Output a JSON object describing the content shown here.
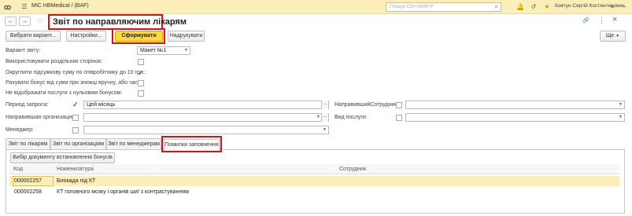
{
  "app": {
    "title": "МІС НВMedical /  (BAF)",
    "search_placeholder": "Пошук Ctrl+Shift+F",
    "user": "Ковтун Сергій Костянтинович"
  },
  "header": {
    "title": "Звіт по направляючим лікарям",
    "back": "←",
    "forward": "→",
    "star": "☆",
    "link": "🔗",
    "more": "⋮",
    "close": "×"
  },
  "toolbar": {
    "select_variant": "Вибрати варіант...",
    "settings": "Настройки...",
    "generate": "Сформувати",
    "print": "Надрукувати",
    "more": "Ще"
  },
  "form": {
    "variant_label": "Варіант звіту:",
    "variant_value": "Макет №1",
    "page_separator_label": "Використовувати роздільник сторінок:",
    "round_label": "Округлити підсумкову суму по співробітнику до 10 грн.:",
    "bonus_calc_label": "Рахувати бонус від суми при знижці вручну, або часу:",
    "zero_bonus_label": "Не відображати послуги з нульовим бонусом:",
    "period_label": "Период запроса:",
    "period_value": "Цей місяць",
    "org_label": "Направившая организация:",
    "manager_label": "Менеджер:",
    "employee_label": "НаправившийСотрудник:",
    "service_label": "Вид послуги:"
  },
  "tabs": [
    {
      "label": "Звіт по лікарям"
    },
    {
      "label": "Звіт по організаціям"
    },
    {
      "label": "Звіт по менеджерам"
    },
    {
      "label": "Помилки заповнення"
    }
  ],
  "panel": {
    "bonus_button": "Вибір документу встановлення бонусів",
    "columns": [
      "Код",
      "Номенклатура",
      "Сотрудник"
    ],
    "rows": [
      {
        "code": "000002257",
        "name": "Блокада під КТ",
        "employee": ""
      },
      {
        "code": "000002258",
        "name": "КТ головного мозку і органів шиї з контрастуванням",
        "employee": ""
      }
    ]
  },
  "colors": {
    "accent": "#ffd83a",
    "highlight": "#d11111",
    "titlebar": "#fbeeb8"
  }
}
